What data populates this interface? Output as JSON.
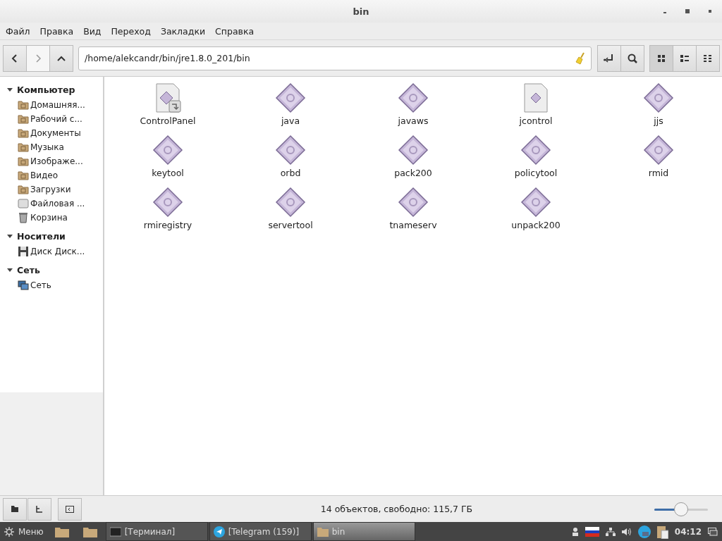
{
  "window": {
    "title": "bin"
  },
  "menu": [
    "Файл",
    "Правка",
    "Вид",
    "Переход",
    "Закладки",
    "Справка"
  ],
  "location": {
    "value": "/home/alekcandr/bin/jre1.8.0_201/bin"
  },
  "view_buttons": [
    {
      "kind": "icons",
      "selected": true
    },
    {
      "kind": "compact",
      "selected": false
    },
    {
      "kind": "list",
      "selected": false
    }
  ],
  "sidebar": {
    "sections": [
      {
        "title": "Компьютер",
        "expanded": true,
        "items": [
          {
            "label": "Домашняя...",
            "kind": "folder",
            "selected": false
          },
          {
            "label": "Рабочий с...",
            "kind": "folder",
            "selected": false
          },
          {
            "label": "Документы",
            "kind": "folder",
            "selected": false
          },
          {
            "label": "Музыка",
            "kind": "folder",
            "selected": false
          },
          {
            "label": "Изображе...",
            "kind": "folder",
            "selected": false
          },
          {
            "label": "Видео",
            "kind": "folder",
            "selected": false
          },
          {
            "label": "Загрузки",
            "kind": "folder",
            "selected": false
          },
          {
            "label": "Файловая ...",
            "kind": "filesystem",
            "selected": false
          },
          {
            "label": "Корзина",
            "kind": "trash",
            "selected": false
          }
        ]
      },
      {
        "title": "Носители",
        "expanded": true,
        "items": [
          {
            "label": "Диск Диск...",
            "kind": "disk",
            "selected": false
          }
        ]
      },
      {
        "title": "Сеть",
        "expanded": true,
        "items": [
          {
            "label": "Сеть",
            "kind": "network",
            "selected": false
          }
        ]
      }
    ]
  },
  "files": [
    {
      "name": "ControlPanel",
      "kind": "link"
    },
    {
      "name": "java",
      "kind": "executable"
    },
    {
      "name": "javaws",
      "kind": "executable"
    },
    {
      "name": "jcontrol",
      "kind": "document"
    },
    {
      "name": "jjs",
      "kind": "executable"
    },
    {
      "name": "keytool",
      "kind": "executable"
    },
    {
      "name": "orbd",
      "kind": "executable"
    },
    {
      "name": "pack200",
      "kind": "executable"
    },
    {
      "name": "policytool",
      "kind": "executable"
    },
    {
      "name": "rmid",
      "kind": "executable"
    },
    {
      "name": "rmiregistry",
      "kind": "executable"
    },
    {
      "name": "servertool",
      "kind": "executable"
    },
    {
      "name": "tnameserv",
      "kind": "executable"
    },
    {
      "name": "unpack200",
      "kind": "executable"
    }
  ],
  "status_bar": {
    "text": "14 объектов, свободно: 115,7 ГБ",
    "zoom": {
      "level": 0.5
    }
  },
  "taskbar": {
    "menu_label": "Меню",
    "windows": [
      {
        "label": "[Терминал]",
        "kind": "terminal",
        "selected": false
      },
      {
        "label": "[Telegram (159)]",
        "kind": "telegram",
        "selected": false
      },
      {
        "label": "bin",
        "kind": "folder",
        "selected": true
      }
    ],
    "clock": "04:12"
  }
}
